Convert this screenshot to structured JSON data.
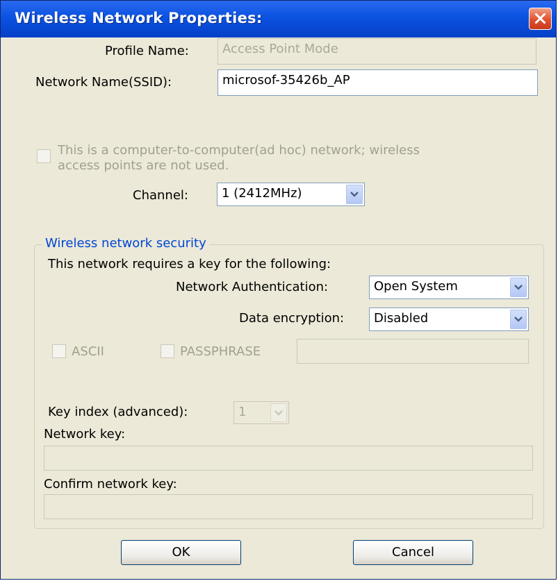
{
  "window": {
    "title": "Wireless Network Properties:"
  },
  "profile": {
    "label": "Profile Name:",
    "value": "Access Point Mode"
  },
  "ssid": {
    "label": "Network Name(SSID):",
    "value": "microsof-35426b_AP"
  },
  "adhoc": {
    "label_line1": "This is a computer-to-computer(ad hoc) network; wireless",
    "label_line2": "access points are not used.",
    "checked": false
  },
  "channel": {
    "label": "Channel:",
    "value": "1  (2412MHz)"
  },
  "security": {
    "legend": "Wireless network security",
    "requires_text": "This network requires a key for the following:",
    "auth_label": "Network Authentication:",
    "auth_value": "Open System",
    "encryption_label": "Data encryption:",
    "encryption_value": "Disabled",
    "ascii_label": "ASCII",
    "passphrase_label": "PASSPHRASE",
    "passphrase_value": "",
    "key_index_label": "Key index (advanced):",
    "key_index_value": "1",
    "network_key_label": "Network key:",
    "network_key_value": "",
    "confirm_key_label": "Confirm network key:",
    "confirm_key_value": ""
  },
  "buttons": {
    "ok": "OK",
    "cancel": "Cancel"
  },
  "colors": {
    "titlebar": "#0a52e0",
    "dialog_bg": "#ece9d8",
    "legend": "#0046d5",
    "close": "#e0502e"
  }
}
